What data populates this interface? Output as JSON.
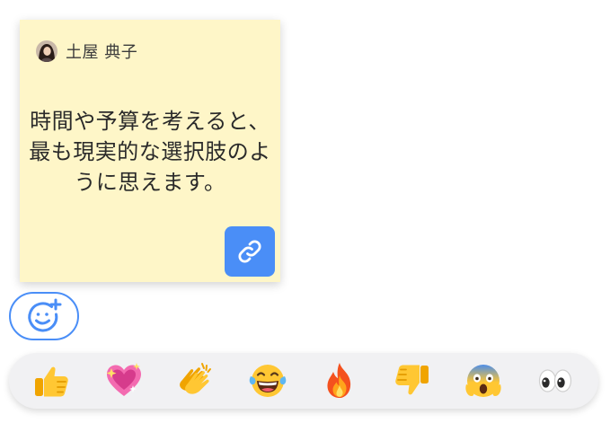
{
  "note": {
    "author_name": "土屋 典子",
    "text": "時間や予算を考えると、最も現実的な選択肢のように思えます。",
    "background_color": "#fef6c8",
    "link_icon": "link-icon"
  },
  "add_reaction": {
    "icon": "add-emoji-icon",
    "accent_color": "#4a8ef7"
  },
  "reactions": [
    {
      "name": "thumbs-up-icon"
    },
    {
      "name": "sparkling-heart-icon"
    },
    {
      "name": "clapping-hands-icon"
    },
    {
      "name": "tears-of-joy-icon"
    },
    {
      "name": "fire-icon"
    },
    {
      "name": "thumbs-down-icon"
    },
    {
      "name": "screaming-face-icon"
    },
    {
      "name": "eyes-icon"
    }
  ]
}
